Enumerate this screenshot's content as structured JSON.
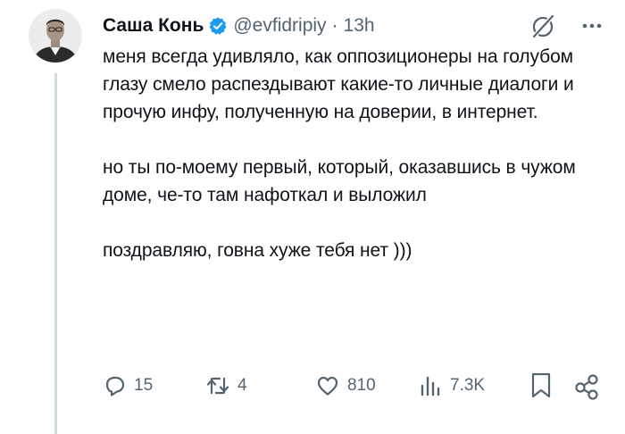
{
  "author": {
    "name": "Саша Конь",
    "handle": "@evfidripiy",
    "separator": "·",
    "time": "13h"
  },
  "tweet": {
    "paragraphs": [
      "меня всегда удивляло, как оппозиционеры на голубом глазу смело распездывают какие-то личные диалоги и прочую инфу, полученную на доверии, в интернет.",
      "но ты по-моему первый, который, оказавшись в чужом доме, че-то там нафоткал и выложил",
      "поздравляю, говна хуже тебя нет )))"
    ]
  },
  "actions": {
    "replies": "15",
    "reposts": "4",
    "likes": "810",
    "views": "7.3K"
  },
  "colors": {
    "verified": "#1d9bf0",
    "muted": "#536471",
    "text": "#0f1419",
    "thread_line": "#cfd9de"
  },
  "icons": [
    "verified-badge-icon",
    "grok-icon",
    "more-icon",
    "reply-icon",
    "repost-icon",
    "like-icon",
    "views-icon",
    "bookmark-icon",
    "share-icon"
  ]
}
